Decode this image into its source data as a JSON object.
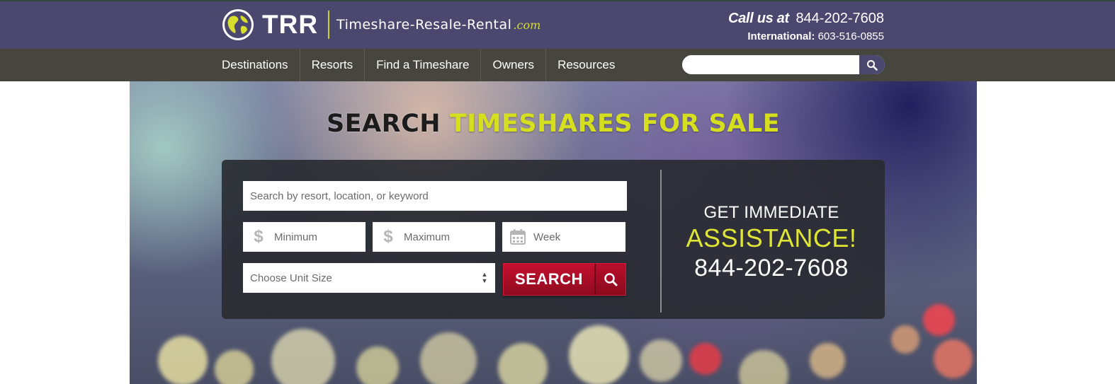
{
  "brand": {
    "logo_text": "TRR",
    "site_prefix": "Timeshare-Resale-Rental",
    "site_suffix": ".com",
    "accent_color": "#d8de2e",
    "header_color": "#4b4870"
  },
  "contact": {
    "call_label": "Call us at",
    "call_number": "844-202-7608",
    "intl_label": "International:",
    "intl_number": "603-516-0855"
  },
  "nav": {
    "items": [
      {
        "label": "Destinations"
      },
      {
        "label": "Resorts"
      },
      {
        "label": "Find a Timeshare"
      },
      {
        "label": "Owners"
      },
      {
        "label": "Resources"
      }
    ],
    "search": {
      "placeholder": "",
      "icon": "search-icon"
    }
  },
  "hero": {
    "title_part1": "SEARCH",
    "title_part2": "TIMESHARES FOR SALE",
    "form": {
      "keyword_placeholder": "Search by resort, location, or keyword",
      "min_placeholder": "Minimum",
      "max_placeholder": "Maximum",
      "week_placeholder": "Week",
      "unit_size_selected": "Choose Unit Size",
      "search_label": "SEARCH",
      "button_color": "#c4102f"
    },
    "assist": {
      "line1": "GET IMMEDIATE",
      "line2": "ASSISTANCE!",
      "phone": "844-202-7608"
    }
  }
}
